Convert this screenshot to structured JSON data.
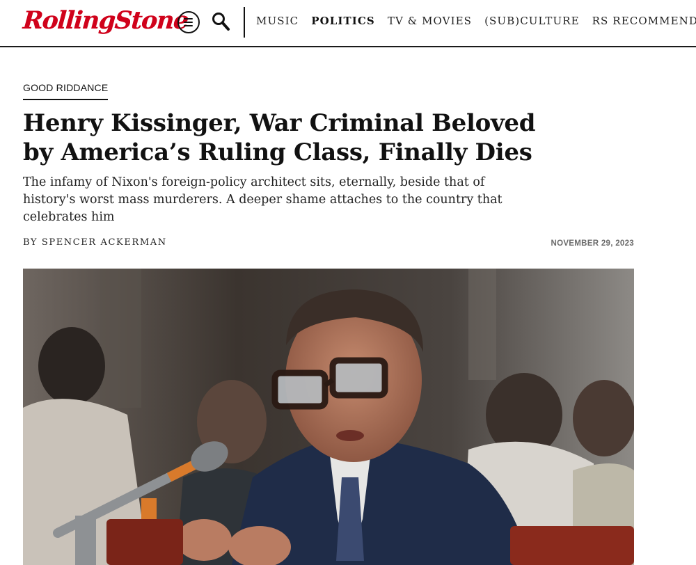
{
  "header": {
    "logo_text": "RollingStone",
    "menu_icon": "hamburger-circle-icon",
    "search_icon": "magnifier-icon",
    "nav": [
      {
        "label": "MUSIC",
        "active": false
      },
      {
        "label": "POLITICS",
        "active": true
      },
      {
        "label": "TV & MOVIES",
        "active": false
      },
      {
        "label": "(SUB)CULTURE",
        "active": false
      },
      {
        "label": "RS RECOMMENDS",
        "active": false
      }
    ],
    "brand_color": "#d0021b"
  },
  "article": {
    "kicker": "GOOD RIDDANCE",
    "headline": "Henry Kissinger, War Criminal Beloved by America’s Ruling Class, Finally Dies",
    "dek": "The infamy of Nixon's foreign-policy architect sits, eternally, beside that of history's worst mass murderers. A deeper shame attaches to the country that celebrates him",
    "byline": "BY SPENCER ACKERMAN",
    "date": "NOVEMBER 29, 2023",
    "hero_image": "hero-photo"
  }
}
